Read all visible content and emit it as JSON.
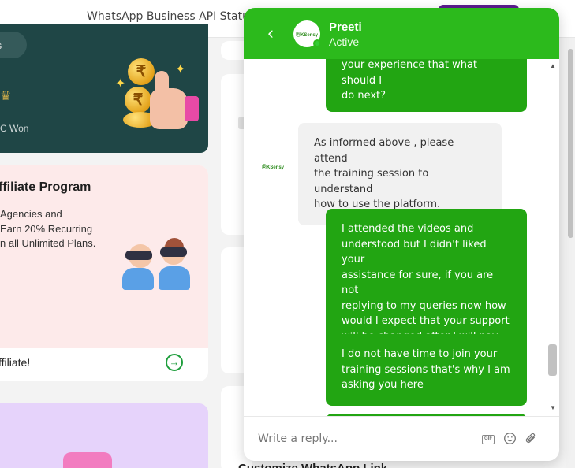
{
  "topbar": {
    "status_text": "WhatsApp Business API Status"
  },
  "left_cards": {
    "dark_card": {
      "pill_text": "ts",
      "won_text": "C Won",
      "coin_symbol": "₹"
    },
    "affiliate_card": {
      "title": "ffiliate Program",
      "lines": [
        "Agencies and",
        "Earn 20% Recurring",
        "n all Unlimited Plans."
      ],
      "footer_text": "ffiliate!",
      "arrow_icon": "→"
    }
  },
  "middle": {
    "bottom_title": "Customize WhatsApp Link"
  },
  "chat": {
    "agent_name": "Preeti",
    "agent_status": "Active",
    "avatar_logo_text": "ⒹKSensy",
    "back_icon": "‹",
    "messages": [
      {
        "direction": "out",
        "lines": [
          "your experience that what should I",
          "do next?"
        ]
      },
      {
        "direction": "in",
        "lines": [
          "As informed above , please attend",
          "the training session to understand",
          "how to use the platform."
        ]
      },
      {
        "direction": "out",
        "lines": [
          "I attended the videos and",
          "understood but I didn't liked your",
          "assistance for sure, if you are not",
          "replying to my queries now how",
          "would I expect that your support",
          "will be changed after I will pay."
        ]
      },
      {
        "direction": "out",
        "lines": [
          "I do not have time to join your",
          "training sessions that's why I am",
          "asking you here"
        ]
      }
    ],
    "composer": {
      "placeholder": "Write a reply...",
      "gif_label": "GIF"
    },
    "colors": {
      "header": "#2cba1c",
      "outgoing_bubble": "#22a512",
      "incoming_bubble": "#f1f1f1"
    }
  }
}
